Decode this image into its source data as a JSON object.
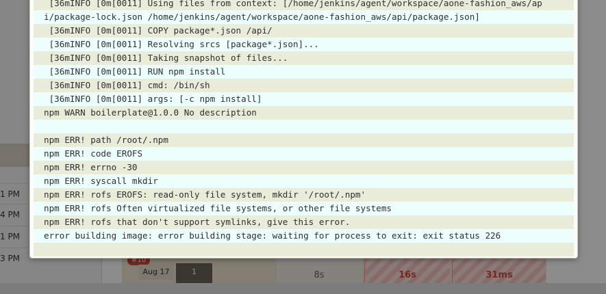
{
  "background": {
    "times": [
      "1 PM",
      "4 PM",
      "1 PM",
      "3 PM"
    ],
    "build_badge": "#10",
    "build_date": "Aug 17",
    "build_commits": "1",
    "stage_durations": [
      "8s",
      "16s",
      "31ms"
    ]
  },
  "log": {
    "lines": [
      " [36mINFO [0m[0011] Using files from context: [/home/jenkins/agent/workspace/aone-fashion_aws/ap",
      "i/package-lock.json /home/jenkins/agent/workspace/aone-fashion_aws/api/package.json]",
      " [36mINFO [0m[0011] COPY package*.json /api/",
      " [36mINFO [0m[0011] Resolving srcs [package*.json]...",
      " [36mINFO [0m[0011] Taking snapshot of files...",
      " [36mINFO [0m[0011] RUN npm install",
      " [36mINFO [0m[0011] cmd: /bin/sh",
      " [36mINFO [0m[0011] args: [-c npm install]",
      "npm WARN boilerplate@1.0.0 No description",
      "",
      "npm ERR! path /root/.npm",
      "npm ERR! code EROFS",
      "npm ERR! errno -30",
      "npm ERR! syscall mkdir",
      "npm ERR! rofs EROFS: read-only file system, mkdir '/root/.npm'",
      "npm ERR! rofs Often virtualized file systems, or other file systems",
      "npm ERR! rofs that don't support symlinks, give this error.",
      "error building image: error building stage: waiting for process to exit: exit status 226",
      ""
    ]
  }
}
